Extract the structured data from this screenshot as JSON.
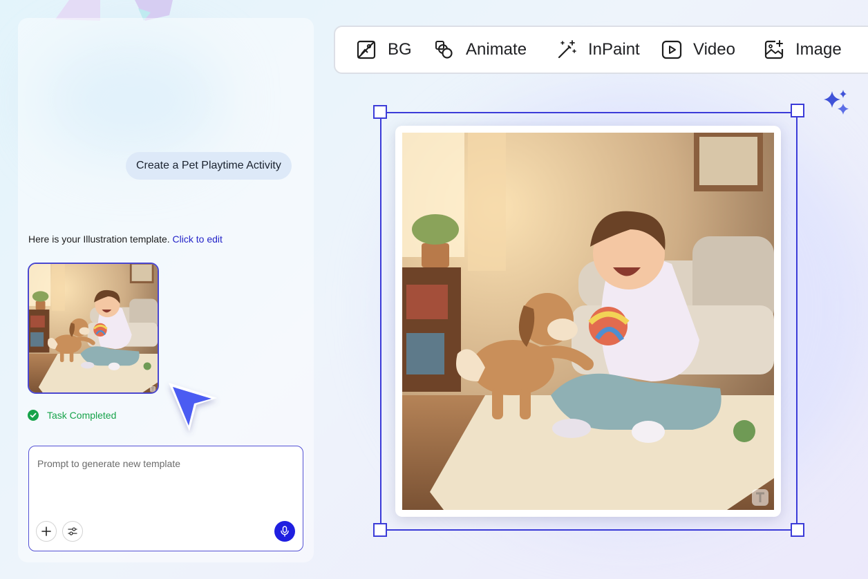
{
  "chat": {
    "user_message": "Create a Pet Playtime Activity",
    "ai_message": "Here is your Illustration template.",
    "ai_link": "Click to edit",
    "task_status": "Task Completed"
  },
  "prompt": {
    "placeholder": "Prompt to generate new template",
    "value": ""
  },
  "toolbar": {
    "items": [
      {
        "label": "BG",
        "icon": "bg-remove-icon"
      },
      {
        "label": "Animate",
        "icon": "animate-icon"
      },
      {
        "label": "InPaint",
        "icon": "magic-wand-icon"
      },
      {
        "label": "Video",
        "icon": "video-play-icon"
      },
      {
        "label": "Image",
        "icon": "image-add-icon"
      }
    ]
  },
  "colors": {
    "accent": "#3b3bd8",
    "link": "#2323c8",
    "success": "#17a34a",
    "mic_button": "#1f1fe0",
    "user_bubble": "#dde9f8"
  }
}
